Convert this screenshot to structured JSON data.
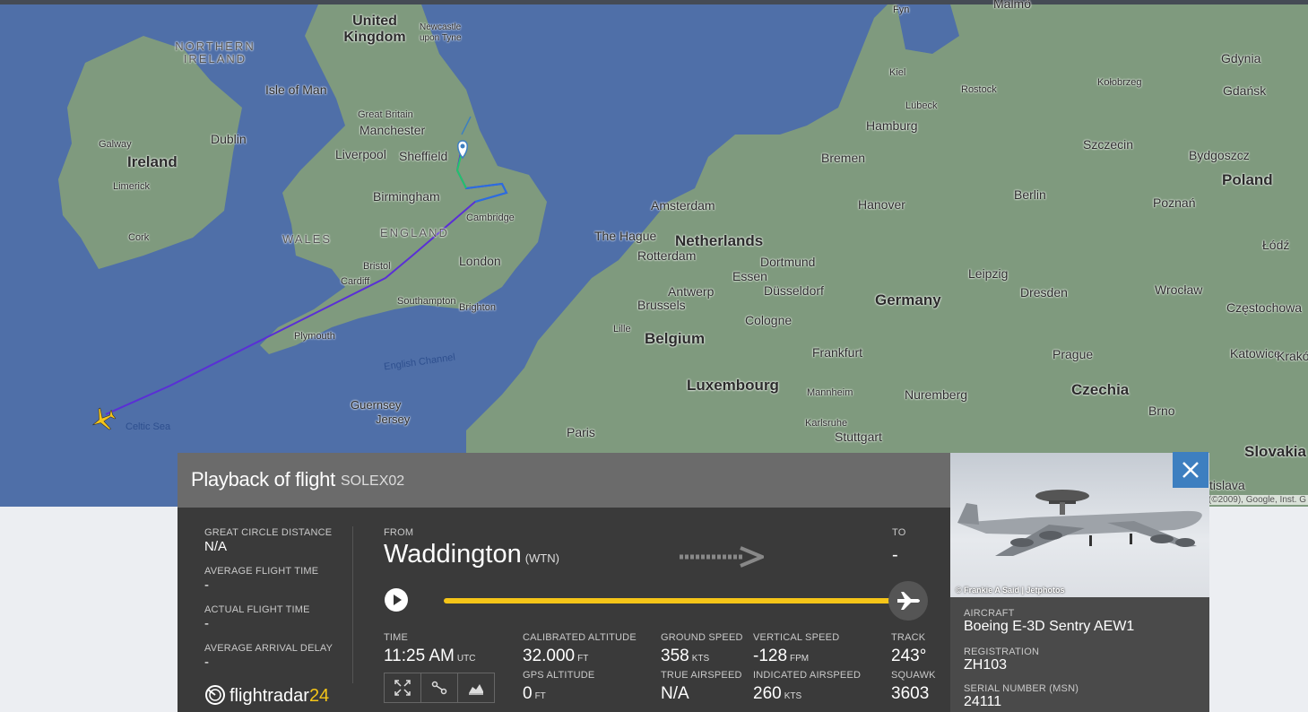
{
  "map": {
    "labels": {
      "united_kingdom": "United Kingdom",
      "northern_ireland": "NORTHERN IRELAND",
      "isle_of_man": "Isle of Man",
      "newcastle": "Newcastle upon Tyne",
      "dublin": "Dublin",
      "galway": "Galway",
      "ireland": "Ireland",
      "limerick": "Limerick",
      "cork": "Cork",
      "great_britain": "Great Britain",
      "manchester": "Manchester",
      "liverpool": "Liverpool",
      "sheffield": "Sheffield",
      "birmingham": "Birmingham",
      "wales": "WALES",
      "england": "ENGLAND",
      "cambridge": "Cambridge",
      "bristol": "Bristol",
      "cardiff": "Cardiff",
      "london": "London",
      "southampton": "Southampton",
      "brighton": "Brighton",
      "plymouth": "Plymouth",
      "english_channel": "English Channel",
      "celtic_sea": "Celtic Sea",
      "guernsey": "Guernsey",
      "jersey": "Jersey",
      "paris": "Paris",
      "lille": "Lille",
      "amsterdam": "Amsterdam",
      "the_hague": "The Hague",
      "rotterdam": "Rotterdam",
      "netherlands": "Netherlands",
      "antwerp": "Antwerp",
      "brussels": "Brussels",
      "belgium": "Belgium",
      "luxembourg": "Luxembourg",
      "essen": "Essen",
      "dortmund": "Dortmund",
      "dusseldorf": "Düsseldorf",
      "cologne": "Cologne",
      "frankfurt": "Frankfurt",
      "mannheim": "Mannheim",
      "karlsruhe": "Karlsruhe",
      "stuttgart": "Stuttgart",
      "nuremberg": "Nuremberg",
      "germany": "Germany",
      "bremen": "Bremen",
      "hamburg": "Hamburg",
      "hanover": "Hanover",
      "kiel": "Kiel",
      "lubeck": "Lübeck",
      "rostock": "Rostock",
      "berlin": "Berlin",
      "leipzig": "Leipzig",
      "dresden": "Dresden",
      "prague": "Prague",
      "czechia": "Czechia",
      "brno": "Brno",
      "slovakia": "Slovakia",
      "szczecin": "Szczecin",
      "kolobrzeg": "Kołobrzeg",
      "gdynia": "Gdynia",
      "gdansk": "Gdańsk",
      "bydgoszcz": "Bydgoszcz",
      "poland": "Poland",
      "poznan": "Poznań",
      "lodz": "Łódź",
      "wroclaw": "Wrocław",
      "czestochowa": "Częstochowa",
      "katowice": "Katowice",
      "krakow": "Krakó",
      "fyn": "Fyn",
      "malmo": "Malmö",
      "bratislava": "tislava"
    },
    "attribution": "5 (©2009), Google, Inst. G"
  },
  "panel": {
    "title": "Playback of flight",
    "callsign": "SOLEX02",
    "great_circle_label": "GREAT CIRCLE DISTANCE",
    "great_circle_value": "N/A",
    "avg_flight_time_label": "AVERAGE FLIGHT TIME",
    "avg_flight_time_value": "-",
    "actual_flight_time_label": "ACTUAL FLIGHT TIME",
    "actual_flight_time_value": "-",
    "avg_arrival_delay_label": "AVERAGE ARRIVAL DELAY",
    "avg_arrival_delay_value": "-",
    "from_label": "FROM",
    "from_airport": "Waddington",
    "from_code": "(WTN)",
    "to_label": "TO",
    "to_airport": "-",
    "time_label": "TIME",
    "time_value": "11:25 AM",
    "time_unit": "UTC",
    "cal_alt_label": "CALIBRATED ALTITUDE",
    "cal_alt_value": "32.000",
    "cal_alt_unit": "FT",
    "gps_alt_label": "GPS ALTITUDE",
    "gps_alt_value": "0",
    "gps_alt_unit": "FT",
    "ground_speed_label": "GROUND SPEED",
    "ground_speed_value": "358",
    "ground_speed_unit": "KTS",
    "true_airspeed_label": "TRUE AIRSPEED",
    "true_airspeed_value": "N/A",
    "vertical_speed_label": "VERTICAL SPEED",
    "vertical_speed_value": "-128",
    "vertical_speed_unit": "FPM",
    "indicated_airspeed_label": "INDICATED AIRSPEED",
    "indicated_airspeed_value": "260",
    "indicated_airspeed_unit": "KTS",
    "track_label": "TRACK",
    "track_value": "243°",
    "squawk_label": "SQUAWK",
    "squawk_value": "3603",
    "progress": 1.0,
    "logo_text": "flightradar",
    "logo_num": "24"
  },
  "aircraft": {
    "photo_credit": "© Frankie A Said | Jetphotos",
    "aircraft_label": "AIRCRAFT",
    "aircraft_value": "Boeing E-3D Sentry AEW1",
    "registration_label": "REGISTRATION",
    "registration_value": "ZH103",
    "serial_label": "SERIAL NUMBER (MSN)",
    "serial_value": "24111"
  },
  "colors": {
    "accent": "#f5c518",
    "close": "#3d7fc0",
    "sea": "#4f6fa8",
    "land": "#7f9a7e"
  }
}
